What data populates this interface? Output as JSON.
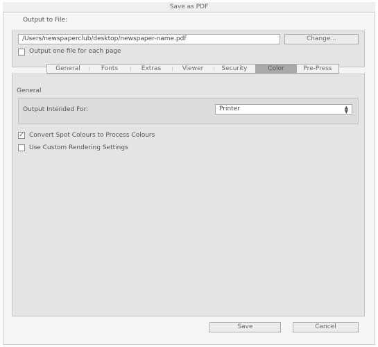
{
  "window": {
    "title": "Save as PDF"
  },
  "output": {
    "label": "Output to File:",
    "path": "/Users/newspaperclub/desktop/newspaper-name.pdf",
    "change_label": "Change...",
    "one_file_label": "Output one file for each page",
    "one_file_checked": false
  },
  "tabs": [
    {
      "label": "General"
    },
    {
      "label": "Fonts"
    },
    {
      "label": "Extras"
    },
    {
      "label": "Viewer"
    },
    {
      "label": "Security"
    },
    {
      "label": "Color",
      "active": true
    },
    {
      "label": "Pre-Press"
    }
  ],
  "color": {
    "section_label": "General",
    "intended_label": "Output Intended For:",
    "intended_value": "Printer",
    "convert_label": "Convert Spot Colours to Process Colours",
    "convert_checked": true,
    "custom_label": "Use Custom Rendering Settings",
    "custom_checked": false
  },
  "footer": {
    "save_label": "Save",
    "cancel_label": "Cancel"
  }
}
